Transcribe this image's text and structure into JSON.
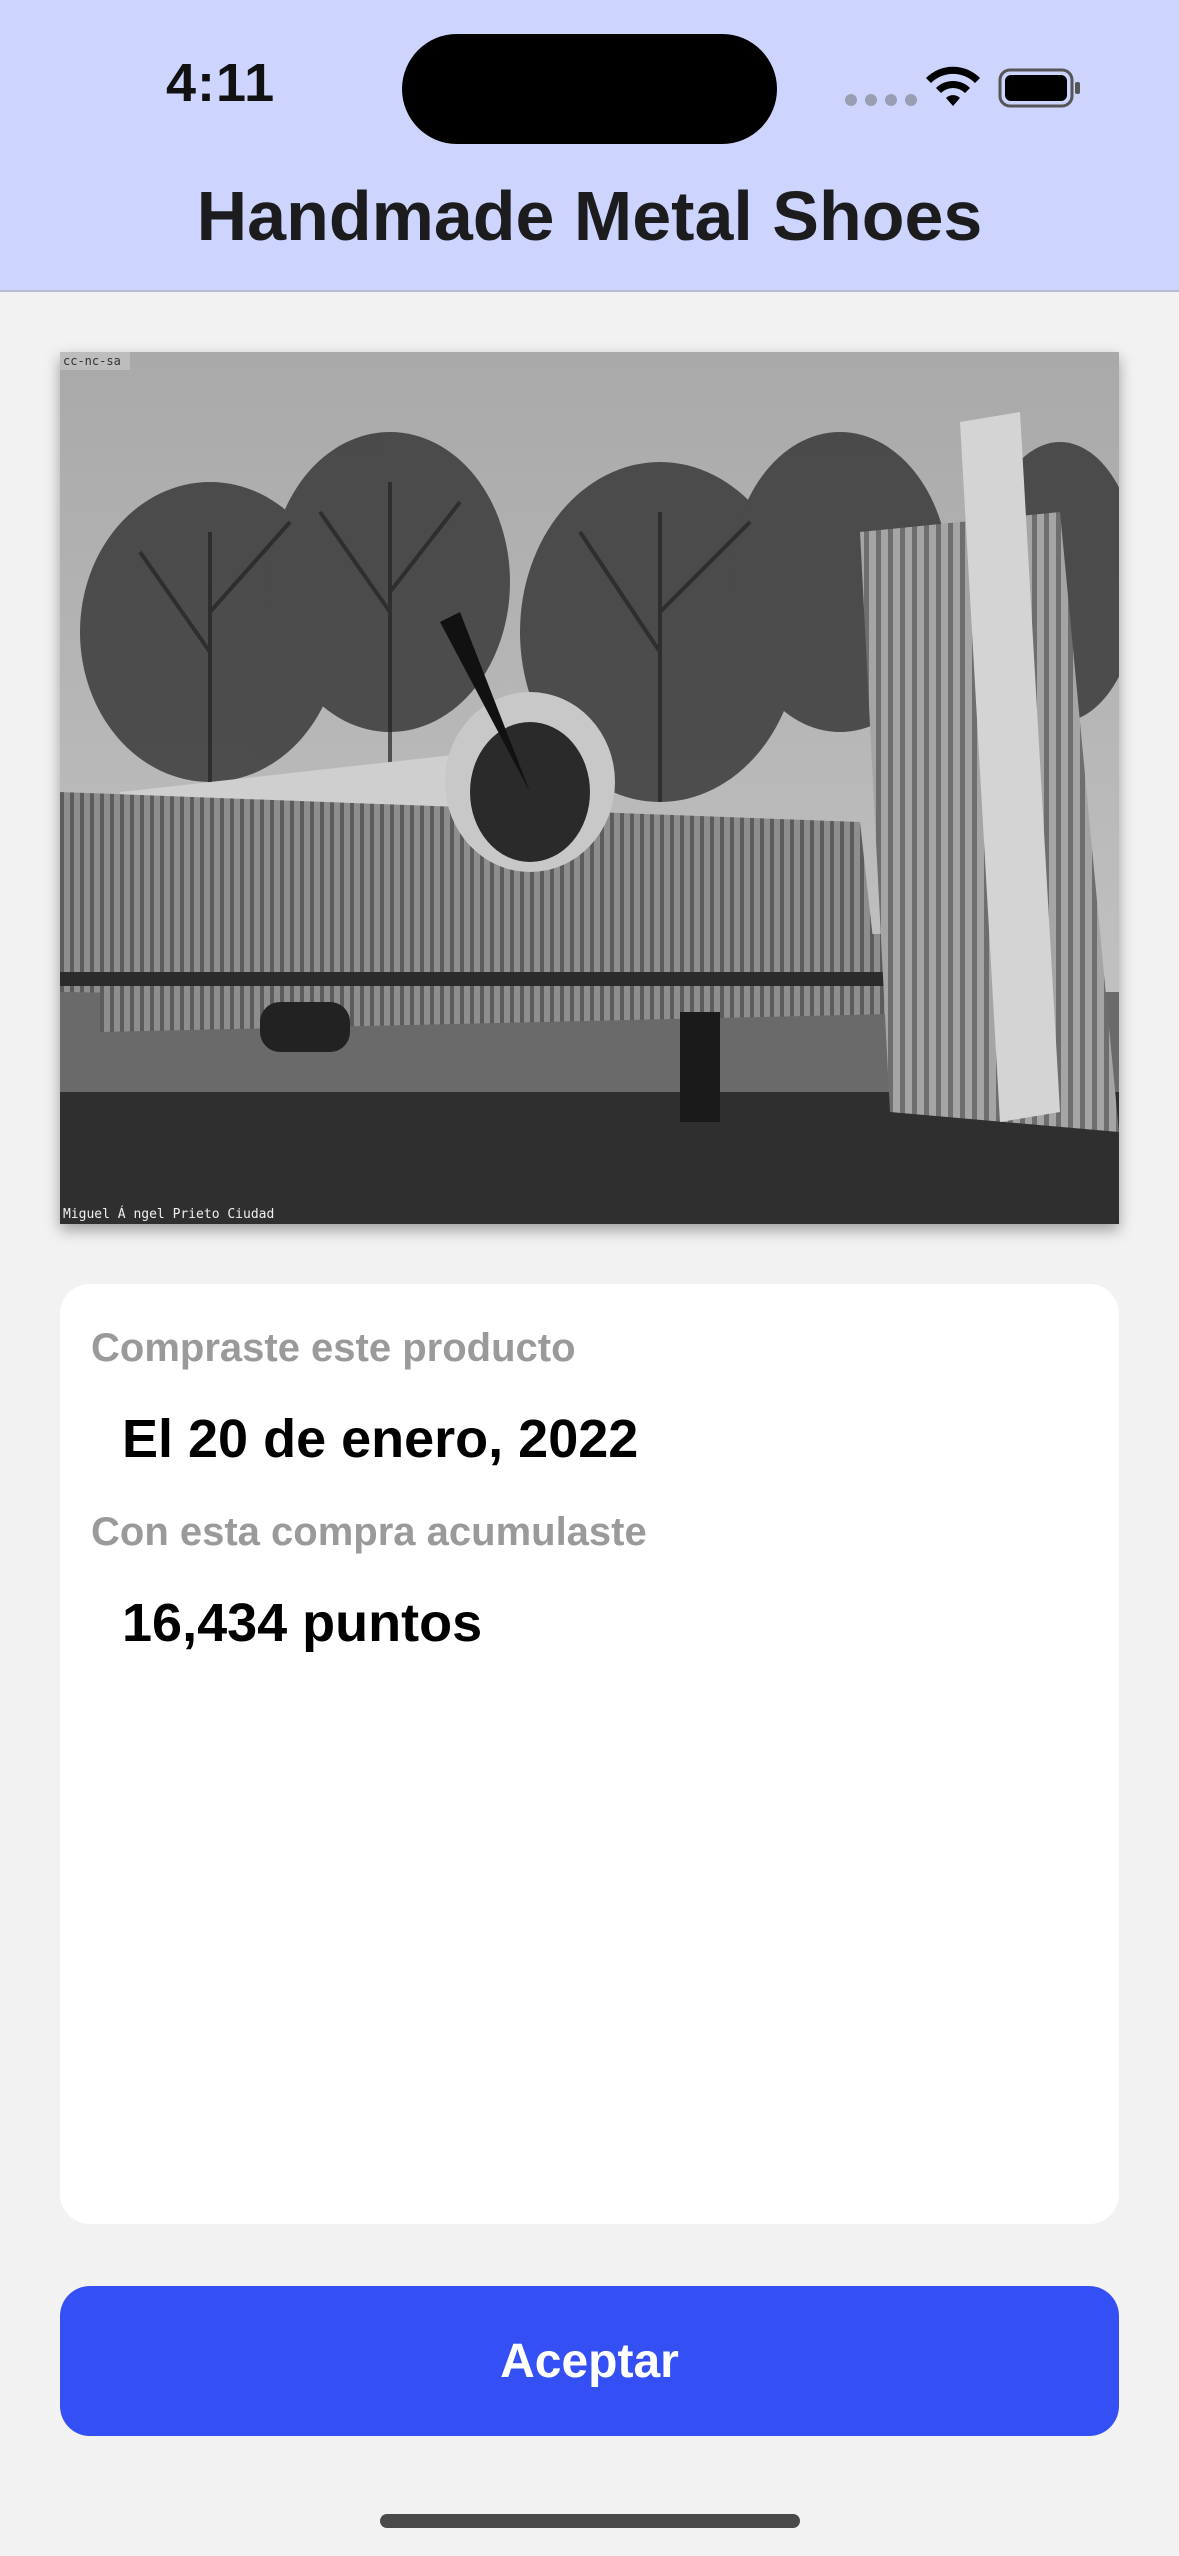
{
  "status_bar": {
    "time": "4:11",
    "icons": [
      "cellular-dots-icon",
      "wifi-icon",
      "battery-icon"
    ]
  },
  "header": {
    "title": "Handmade Metal Shoes",
    "background_color": "#cdd4fe"
  },
  "photo": {
    "description_icon": "airplane-photo",
    "license_text": "cc-nc-sa",
    "credit_text": "Miguel Á ngel Prieto Ciudad"
  },
  "purchase_info": {
    "purchase_label": "Compraste este producto",
    "purchase_date": "El 20 de enero, 2022",
    "points_label": "Con esta compra acumulaste",
    "points_value": "16,434 puntos"
  },
  "actions": {
    "accept_label": "Aceptar",
    "accent_color": "#3450f4"
  }
}
